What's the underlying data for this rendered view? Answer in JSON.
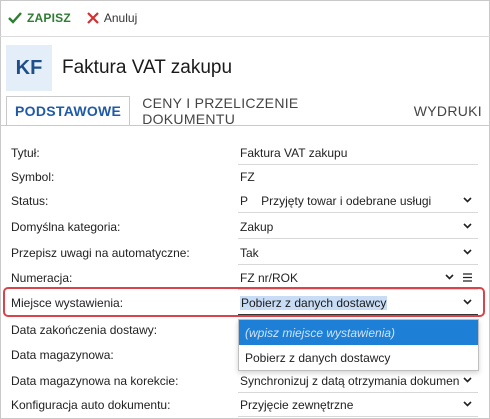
{
  "toolbar": {
    "save_label": "ZAPISZ",
    "cancel_label": "Anuluj"
  },
  "header": {
    "badge": "KF",
    "title": "Faktura VAT zakupu"
  },
  "tabs": [
    {
      "label": "PODSTAWOWE",
      "active": true
    },
    {
      "label": "CENY I PRZELICZENIE DOKUMENTU",
      "active": false
    },
    {
      "label": "WYDRUKI",
      "active": false
    }
  ],
  "form": {
    "tytul": {
      "label": "Tytuł:",
      "value": "Faktura VAT zakupu"
    },
    "symbol": {
      "label": "Symbol:",
      "value": "FZ"
    },
    "status": {
      "label": "Status:",
      "code": "P",
      "value": "Przyjęty towar i odebrane usługi"
    },
    "kategoria": {
      "label": "Domyślna kategoria:",
      "value": "Zakup"
    },
    "przepisz": {
      "label": "Przepisz uwagi na automatyczne:",
      "value": "Tak"
    },
    "numeracja": {
      "label": "Numeracja:",
      "value": "FZ nr/ROK"
    },
    "miejsce": {
      "label": "Miejsce wystawienia:",
      "value": "Pobierz z danych dostawcy"
    },
    "data_zak": {
      "label": "Data zakończenia dostawy:"
    },
    "data_mag": {
      "label": "Data magazynowa:"
    },
    "data_kor": {
      "label": "Data magazynowa na korekcie:",
      "value": "Synchronizuj z datą otrzymania dokumen"
    },
    "konfig": {
      "label": "Konfiguracja auto dokumentu:",
      "value": "Przyjęcie zewnętrzne"
    }
  },
  "dropdown": {
    "options": [
      "(wpisz miejsce wystawienia)",
      "Pobierz z danych dostawcy"
    ]
  },
  "colors": {
    "accent": "#1e5aa8",
    "save_green": "#2e7d32",
    "cancel_red": "#d32f2f",
    "highlight_red": "#d9444a",
    "option_blue": "#1e7fd6"
  }
}
